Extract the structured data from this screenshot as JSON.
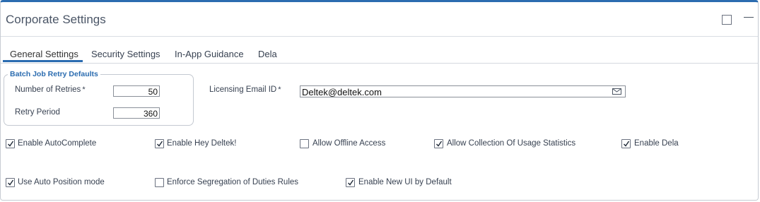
{
  "window": {
    "title": "Corporate Settings"
  },
  "tabs": [
    {
      "label": "General Settings",
      "active": true
    },
    {
      "label": "Security Settings",
      "active": false
    },
    {
      "label": "In-App Guidance",
      "active": false
    },
    {
      "label": "Dela",
      "active": false
    }
  ],
  "batch": {
    "legend": "Batch Job Retry Defaults",
    "retries_label": "Number of Retries",
    "retries_value": "50",
    "period_label": "Retry Period",
    "period_value": "360",
    "required_mark": "*"
  },
  "licensing": {
    "label": "Licensing Email ID",
    "required_mark": "*",
    "value": "Deltek@deltek.com"
  },
  "checkboxes": [
    {
      "label": "Enable AutoComplete",
      "checked": true
    },
    {
      "label": "Enable Hey Deltek!",
      "checked": true
    },
    {
      "label": "Allow Offline Access",
      "checked": false
    },
    {
      "label": "Allow Collection Of Usage Statistics",
      "checked": true
    },
    {
      "label": "Enable Dela",
      "checked": true
    },
    {
      "label": "Use Auto Position mode",
      "checked": true
    },
    {
      "label": "Enforce Segregation of Duties Rules",
      "checked": false
    },
    {
      "label": "Enable New UI by Default",
      "checked": true
    }
  ],
  "colors": {
    "accent": "#2b6cb0",
    "text": "#374151",
    "border": "#c4c9d1"
  }
}
